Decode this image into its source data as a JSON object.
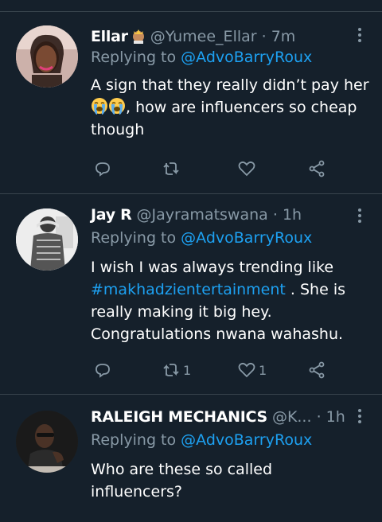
{
  "tweets": [
    {
      "name": "Ellar",
      "handle": "@Yumee_Ellar",
      "sep": "·",
      "time": "7m",
      "reply_prefix": "Replying to",
      "reply_to": "@AdvoBarryRoux",
      "text_1": "A sign that they really didn’t pay her",
      "text_2": ", how are influencers so cheap",
      "text_3": "though",
      "reply_count": "",
      "retweet_count": "",
      "like_count": ""
    },
    {
      "name": "Jay R",
      "handle": "@Jayramatswana",
      "sep": "·",
      "time": "1h",
      "reply_prefix": "Replying to",
      "reply_to": "@AdvoBarryRoux",
      "text_1": "I wish I was always trending like",
      "hashtag": "#makhadzientertainment",
      "text_2": ". She is",
      "text_3": "really making it big hey.",
      "text_4": "Congratulations nwana wahashu.",
      "reply_count": "",
      "retweet_count": "1",
      "like_count": "1"
    },
    {
      "name": "RALEIGH MECHANICS",
      "handle": "@K...",
      "sep": "·",
      "time": "1h",
      "reply_prefix": "Replying to",
      "reply_to": "@AdvoBarryRoux",
      "text_1": "Who are these so called",
      "text_2": "influencers?"
    }
  ],
  "colors": {
    "background": "#15202b",
    "secondary_text": "#8899a6",
    "link": "#1da1f2",
    "divider": "#38444d"
  },
  "icons": [
    "reply-icon",
    "retweet-icon",
    "like-icon",
    "share-icon",
    "more-icon",
    "crying-emoji",
    "princess-emoji"
  ]
}
